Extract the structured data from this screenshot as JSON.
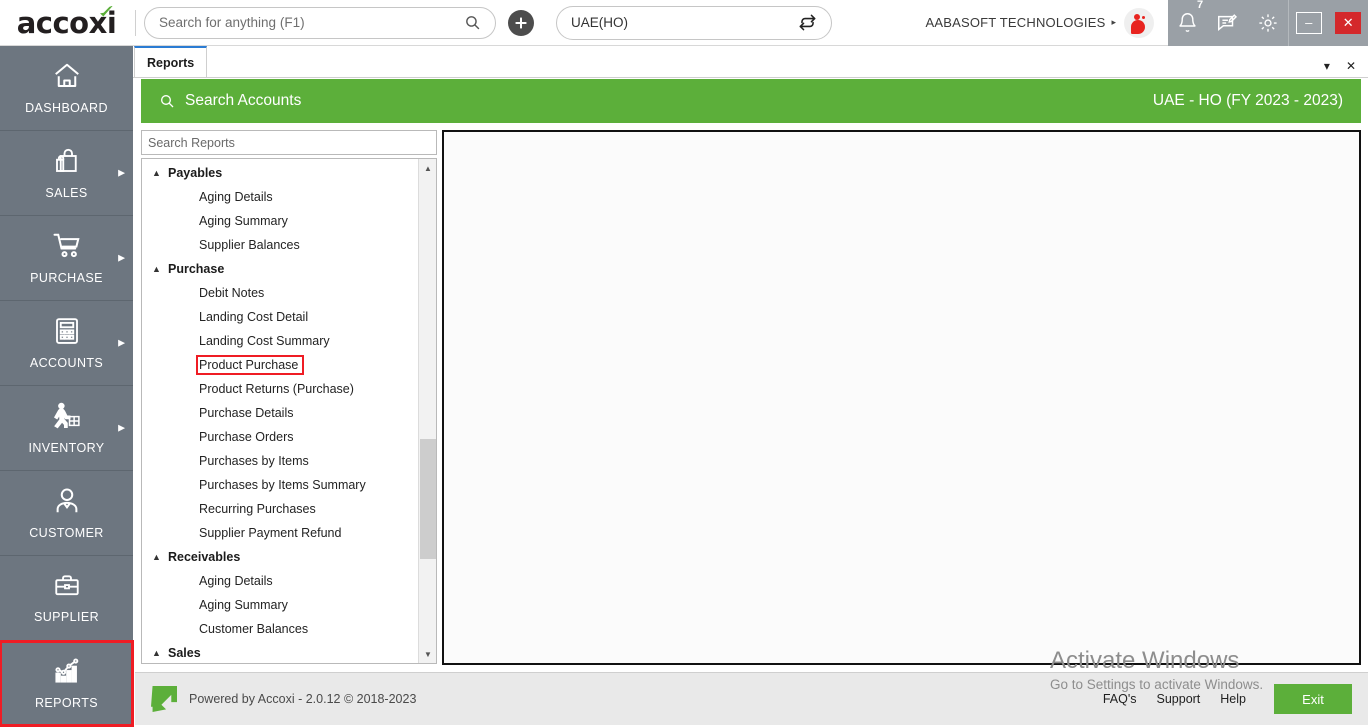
{
  "app": {
    "brand": "accoxi"
  },
  "topbar": {
    "search_placeholder": "Search for anything (F1)",
    "search_value": "",
    "search_icon": "search-icon",
    "add_icon": "plus-icon",
    "branch_value": "UAE(HO)",
    "branch_switch_icon": "switch-icon",
    "company_name": "AABASOFT TECHNOLOGIES",
    "company_caret": "▸",
    "avatar_icon": "user-avatar",
    "notification_icon": "bell-icon",
    "notification_count": "7",
    "message_icon": "message-icon",
    "settings_icon": "gear-icon",
    "minimize_label": "–",
    "close_label": "✕"
  },
  "sidebar": {
    "items": [
      {
        "label": "DASHBOARD",
        "icon": "home-icon",
        "has_arrow": false,
        "highlighted": false
      },
      {
        "label": "SALES",
        "icon": "shopping-bag-icon",
        "has_arrow": true,
        "highlighted": false
      },
      {
        "label": "PURCHASE",
        "icon": "shopping-cart-icon",
        "has_arrow": true,
        "highlighted": false
      },
      {
        "label": "ACCOUNTS",
        "icon": "calculator-icon",
        "has_arrow": true,
        "highlighted": false
      },
      {
        "label": "INVENTORY",
        "icon": "warehouse-worker-icon",
        "has_arrow": true,
        "highlighted": false
      },
      {
        "label": "CUSTOMER",
        "icon": "person-icon",
        "has_arrow": false,
        "highlighted": false
      },
      {
        "label": "SUPPLIER",
        "icon": "briefcase-icon",
        "has_arrow": false,
        "highlighted": false
      },
      {
        "label": "REPORTS",
        "icon": "bar-chart-icon",
        "has_arrow": false,
        "highlighted": true
      }
    ]
  },
  "tabstrip": {
    "tabs": [
      {
        "label": "Reports",
        "active": true
      }
    ],
    "dropdown_icon": "▾",
    "close_icon": "✕"
  },
  "page_header": {
    "search_icon": "search-icon",
    "title": "Search Accounts",
    "context": "UAE - HO (FY 2023 - 2023)",
    "accent_color": "#5CAF3A"
  },
  "report_panel": {
    "search_placeholder": "Search Reports",
    "search_value": "",
    "selected_report": "Product Purchase",
    "highlight_color": "#EF1C24",
    "scrollbar": {
      "up_icon": "▲",
      "down_icon": "▼"
    },
    "groups": [
      {
        "label": "Payables",
        "expanded": true,
        "collapse_icon": "▲",
        "items": [
          "Aging Details",
          "Aging Summary",
          "Supplier Balances"
        ]
      },
      {
        "label": "Purchase",
        "expanded": true,
        "collapse_icon": "▲",
        "items": [
          "Debit Notes",
          "Landing Cost Detail",
          "Landing Cost Summary",
          "Product Purchase",
          "Product Returns (Purchase)",
          "Purchase Details",
          "Purchase Orders",
          "Purchases by Items",
          "Purchases by Items Summary",
          "Recurring Purchases",
          "Supplier Payment Refund"
        ]
      },
      {
        "label": "Receivables",
        "expanded": true,
        "collapse_icon": "▲",
        "items": [
          "Aging Details",
          "Aging Summary",
          "Customer Balances"
        ]
      },
      {
        "label": "Sales",
        "expanded": true,
        "collapse_icon": "▲",
        "items": []
      }
    ]
  },
  "watermark": {
    "line1": "Activate Windows",
    "line2": "Go to Settings to activate Windows."
  },
  "footer": {
    "logo_icon": "accoxi-arrow-logo",
    "powered_by": "Powered by Accoxi - 2.0.12 © 2018-2023",
    "links": [
      "FAQ's",
      "Support",
      "Help"
    ],
    "exit_label": "Exit"
  }
}
